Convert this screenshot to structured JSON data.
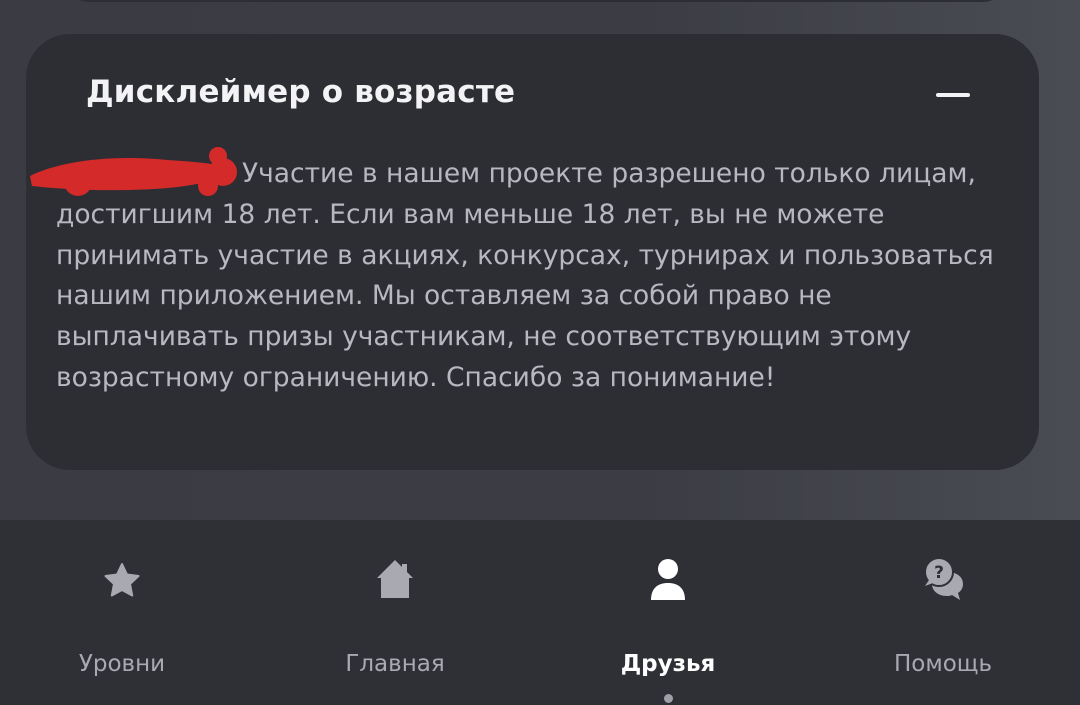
{
  "disclaimer": {
    "title": "Дисклеймер о возрасте",
    "text": "Участие в нашем проекте разрешено только лицам, достигшим 18 лет. Если вам меньше 18 лет, вы не можете принимать участие в акциях, конкурсах, турнирах и пользоваться нашим приложением. Мы оставляем за собой право не выплачивать призы участникам, не соответствующим этому возрастному ограничению. Спасибо за понимание!"
  },
  "nav": {
    "items": [
      {
        "label": "Уровни",
        "icon": "star-icon"
      },
      {
        "label": "Главная",
        "icon": "home-icon"
      },
      {
        "label": "Друзья",
        "icon": "user-icon",
        "active": true
      },
      {
        "label": "Помощь",
        "icon": "help-chat-icon"
      }
    ]
  },
  "colors": {
    "background": "#3a3b42",
    "card": "#2d2e34",
    "navbar": "#2f3036",
    "redaction": "#d42a2a"
  }
}
